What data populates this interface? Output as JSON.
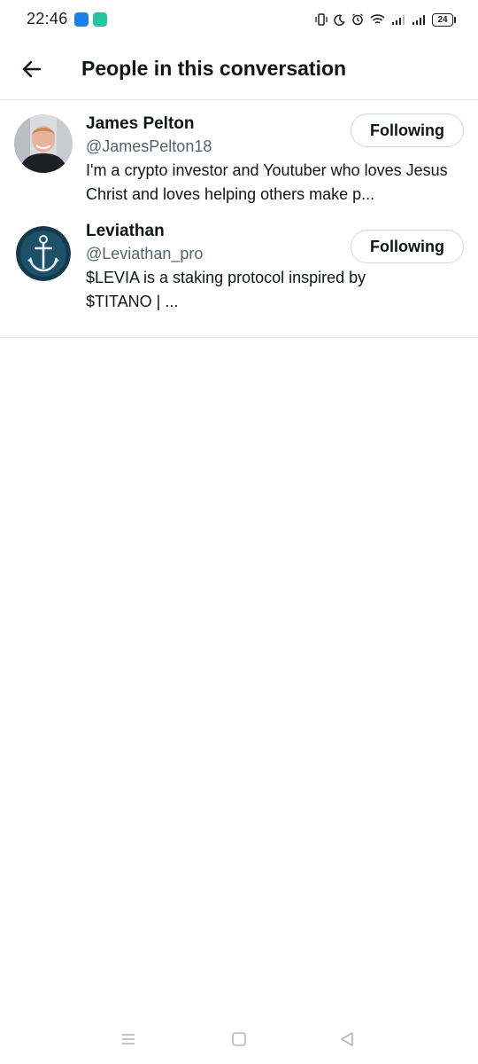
{
  "status_bar": {
    "time": "22:46",
    "battery": "24"
  },
  "header": {
    "title": "People in this conversation",
    "back_icon": "arrow-left-icon"
  },
  "people": [
    {
      "name": "James Pelton",
      "handle": "@JamesPelton18",
      "bio": "I'm a crypto investor and Youtuber who loves Jesus Christ and loves helping others make p...",
      "button_label": "Following"
    },
    {
      "name": "Leviathan",
      "handle": "@Leviathan_pro",
      "bio": "$LEVIA is a staking protocol inspired by $TITANO | ...",
      "button_label": "Following"
    }
  ],
  "nav_bar": {
    "items": [
      "menu-icon",
      "home-icon",
      "back-triangle-icon"
    ]
  },
  "colors": {
    "text_primary": "#0f1419",
    "text_secondary": "#536471",
    "divider": "#e1e8ed",
    "button_border": "#cfd9de"
  }
}
